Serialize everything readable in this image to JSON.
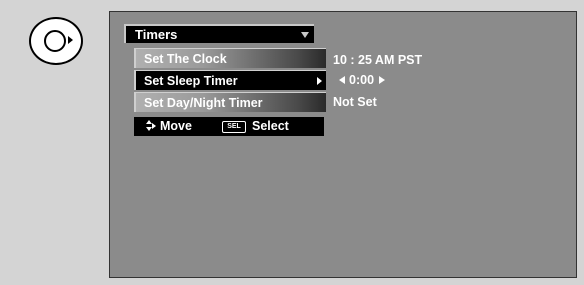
{
  "remote": {
    "nav_button_icon": "circle-right-arrow-icon"
  },
  "menu": {
    "title": "Timers",
    "title_caret_icon": "caret-down-icon",
    "items": [
      {
        "label": "Set The Clock",
        "value": "10 : 25 AM PST",
        "selected": false
      },
      {
        "label": "Set Sleep Timer",
        "value": "0:00",
        "selected": true,
        "has_submenu": true
      },
      {
        "label": "Set Day/Night Timer",
        "value": "Not Set",
        "selected": false
      }
    ]
  },
  "hint_bar": {
    "move_icon": "arrows-updown-icon",
    "move_label": "Move",
    "select_icon_text": "SEL",
    "select_label": "Select"
  },
  "colors": {
    "page_bg": "#d4d4d4",
    "screen_bg": "#8b8b8b",
    "highlight": "#000000",
    "text": "#ffffff"
  }
}
